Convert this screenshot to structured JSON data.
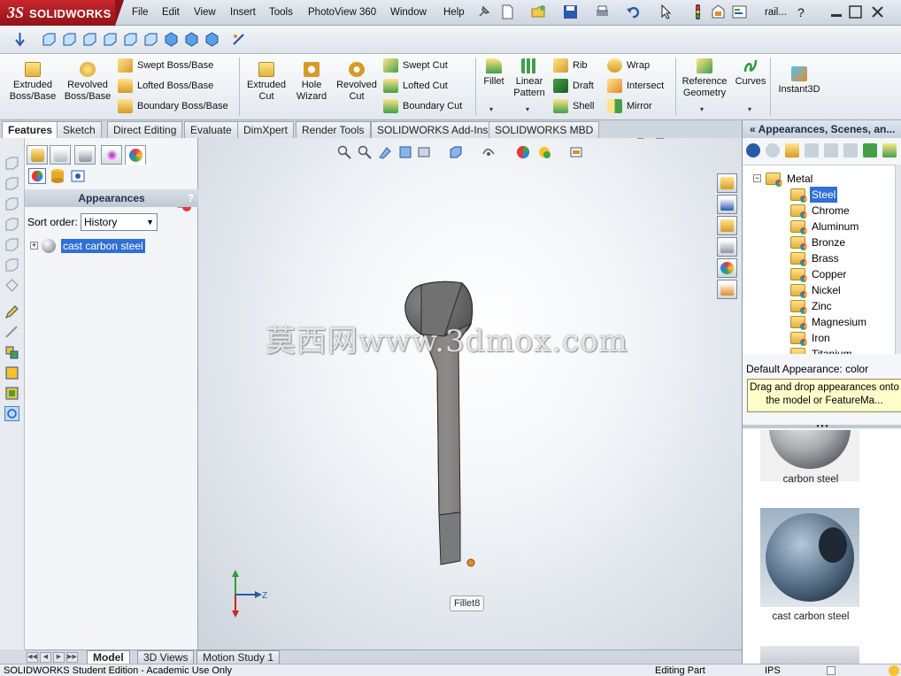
{
  "app": {
    "logo_prefix": "3S",
    "logo_text": "SOLIDWORKS",
    "menu": [
      "File",
      "Edit",
      "View",
      "Insert",
      "Tools",
      "PhotoView 360",
      "Window",
      "Help"
    ],
    "doc_name": "rail...",
    "search_glyph": "?"
  },
  "ribbon": {
    "extruded_boss": "Extruded\nBoss/Base",
    "revolved_boss": "Revolved\nBoss/Base",
    "swept_boss": "Swept Boss/Base",
    "lofted_boss": "Lofted Boss/Base",
    "boundary_boss": "Boundary Boss/Base",
    "extruded_cut": "Extruded\nCut",
    "hole_wizard": "Hole\nWizard",
    "revolved_cut": "Revolved\nCut",
    "swept_cut": "Swept Cut",
    "lofted_cut": "Lofted Cut",
    "boundary_cut": "Boundary Cut",
    "fillet": "Fillet",
    "linear_pattern": "Linear\nPattern",
    "rib": "Rib",
    "draft": "Draft",
    "shell": "Shell",
    "wrap": "Wrap",
    "intersect": "Intersect",
    "mirror": "Mirror",
    "reference_geometry": "Reference\nGeometry",
    "curves": "Curves",
    "instant3d": "Instant3D"
  },
  "tabs": [
    "Features",
    "Sketch",
    "Direct Editing",
    "Evaluate",
    "DimXpert",
    "Render Tools",
    "SOLIDWORKS Add-Ins",
    "SOLIDWORKS MBD"
  ],
  "feature_manager": {
    "appearances_title": "Appearances",
    "help": "?",
    "sort_label": "Sort order:",
    "sort_value": "History",
    "tree_item": "cast carbon steel"
  },
  "viewport": {
    "watermark": "莫西网www.3dmox.com",
    "tooltip": "Fillet8",
    "axis_z": "Z"
  },
  "task_pane": {
    "title": "Appearances, Scenes, an...",
    "tree": [
      {
        "label": "Metal",
        "level": 0
      },
      {
        "label": "Steel",
        "level": 1,
        "selected": true
      },
      {
        "label": "Chrome",
        "level": 1
      },
      {
        "label": "Aluminum",
        "level": 1
      },
      {
        "label": "Bronze",
        "level": 1
      },
      {
        "label": "Brass",
        "level": 1
      },
      {
        "label": "Copper",
        "level": 1
      },
      {
        "label": "Nickel",
        "level": 1
      },
      {
        "label": "Zinc",
        "level": 1
      },
      {
        "label": "Magnesium",
        "level": 1
      },
      {
        "label": "Iron",
        "level": 1
      },
      {
        "label": "Titanium",
        "level": 1
      }
    ],
    "default_appearance": "Default Appearance: color",
    "hint": "Drag and drop appearances onto the model or FeatureMa...",
    "swatches": [
      "carbon steel",
      "cast carbon steel"
    ]
  },
  "bottom_tabs": [
    "Model",
    "3D Views",
    "Motion Study 1"
  ],
  "status": {
    "edition": "SOLIDWORKS Student Edition - Academic Use Only",
    "mode": "Editing Part",
    "units": "IPS"
  },
  "colors": {
    "brand_red": "#c9252c",
    "selection_blue": "#2f6fd6",
    "hint_yellow": "#ffffcc"
  }
}
